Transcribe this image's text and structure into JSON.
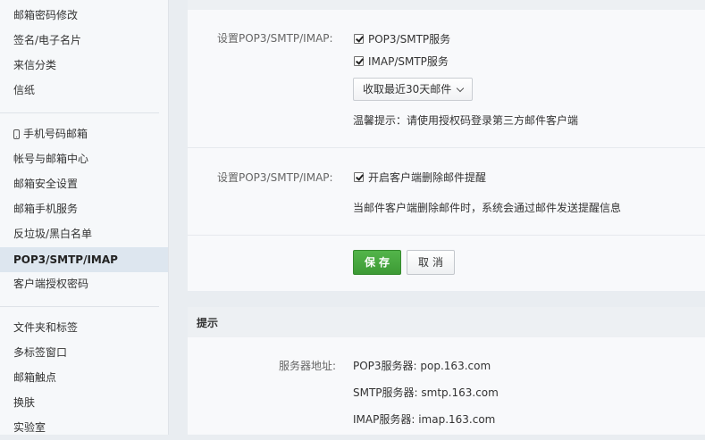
{
  "sidebar": {
    "group1": [
      "邮箱密码修改",
      "签名/电子名片",
      "来信分类",
      "信纸"
    ],
    "group2": [
      "手机号码邮箱",
      "帐号与邮箱中心",
      "邮箱安全设置",
      "邮箱手机服务",
      "反垃圾/黑白名单",
      "POP3/SMTP/IMAP",
      "客户端授权密码"
    ],
    "group3": [
      "文件夹和标签",
      "多标签窗口",
      "邮箱触点",
      "换肤",
      "实验室"
    ],
    "active": "POP3/SMTP/IMAP",
    "phone_icon": "mobile-phone-icon"
  },
  "section1": {
    "label": "设置POP3/SMTP/IMAP:",
    "pop3_smtp": "POP3/SMTP服务",
    "imap_smtp": "IMAP/SMTP服务",
    "receive_range": "收取最近30天邮件",
    "hint": "温馨提示：请使用授权码登录第三方邮件客户端"
  },
  "section2": {
    "label": "设置POP3/SMTP/IMAP:",
    "delete_alert": "开启客户端删除邮件提醒",
    "desc": "当邮件客户端删除邮件时，系统会通过邮件发送提醒信息"
  },
  "actions": {
    "save": "保存",
    "cancel": "取消"
  },
  "tips": {
    "title": "提示",
    "server_label": "服务器地址:",
    "pop3": "POP3服务器: pop.163.com",
    "smtp": "SMTP服务器: smtp.163.com",
    "imap": "IMAP服务器: imap.163.com"
  },
  "colors": {
    "accent_green": "#3d9a35",
    "active_item_bg": "#dde6ef"
  }
}
